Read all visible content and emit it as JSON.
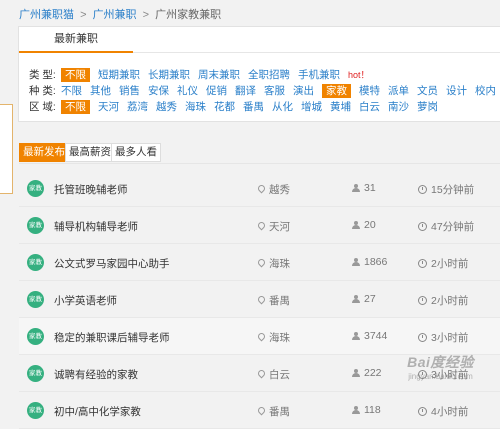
{
  "breadcrumb": {
    "items": [
      "广州兼职猫",
      "广州兼职",
      "广州家教兼职"
    ],
    "separator": ">"
  },
  "filter": {
    "tab_label": "最新兼职",
    "hot_label": "hot！",
    "rows": [
      {
        "label": "类  型:",
        "options": [
          "不限",
          "短期兼职",
          "长期兼职",
          "周末兼职",
          "全职招聘",
          "手机兼职"
        ],
        "selected": 0
      },
      {
        "label": "种  类:",
        "options": [
          "不限",
          "其他",
          "销售",
          "安保",
          "礼仪",
          "促销",
          "翻译",
          "客服",
          "演出",
          "家教",
          "模特",
          "派单",
          "文员",
          "设计",
          "校内"
        ],
        "selected": 9
      },
      {
        "label": "区  域:",
        "options": [
          "不限",
          "天河",
          "荔湾",
          "越秀",
          "海珠",
          "花都",
          "番禺",
          "从化",
          "增城",
          "黄埔",
          "白云",
          "南沙",
          "萝岗"
        ],
        "selected": 0
      }
    ]
  },
  "sort_tabs": {
    "labels": [
      "最新发布",
      "最高薪资",
      "最多人看"
    ],
    "active": 0
  },
  "jobs": [
    {
      "badge": "家教",
      "title": "托管班晚辅老师",
      "location": "越秀",
      "views": "31",
      "time": "15分钟前"
    },
    {
      "badge": "家教",
      "title": "辅导机构辅导老师",
      "location": "天河",
      "views": "20",
      "time": "47分钟前"
    },
    {
      "badge": "家教",
      "title": "公文式罗马家园中心助手",
      "location": "海珠",
      "views": "1866",
      "time": "2小时前"
    },
    {
      "badge": "家教",
      "title": "小学英语老师",
      "location": "番禺",
      "views": "27",
      "time": "2小时前"
    },
    {
      "badge": "家教",
      "title": "稳定的兼职课后辅导老师",
      "location": "海珠",
      "views": "3744",
      "time": "3小时前"
    },
    {
      "badge": "家教",
      "title": "诚聘有经验的家教",
      "location": "白云",
      "views": "222",
      "time": "3小时前"
    },
    {
      "badge": "家教",
      "title": "初中/高中化学家教",
      "location": "番禺",
      "views": "118",
      "time": "4小时前"
    }
  ],
  "watermark": {
    "brand": "Bai度经验",
    "url": "jingyan.baidu.com"
  },
  "colors": {
    "accent": "#f08300",
    "link": "#2a7fc9",
    "badge": "#35b080",
    "hot": "#e02020"
  }
}
